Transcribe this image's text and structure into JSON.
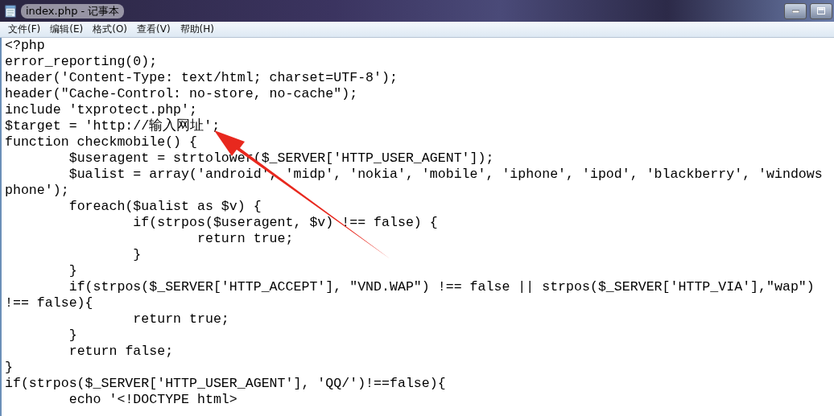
{
  "window": {
    "title": "index.php - 记事本"
  },
  "menu": [
    "文件(F)",
    "编辑(E)",
    "格式(O)",
    "查看(V)",
    "帮助(H)"
  ],
  "editor": {
    "lines": [
      "<?php",
      "error_reporting(0);",
      "header('Content-Type: text/html; charset=UTF-8');",
      "header(\"Cache-Control: no-store, no-cache\");",
      "include 'txprotect.php';",
      "$target = 'http://输入网址';",
      "function checkmobile() {",
      "\t$useragent = strtolower($_SERVER['HTTP_USER_AGENT']);",
      "\t$ualist = array('android', 'midp', 'nokia', 'mobile', 'iphone', 'ipod', 'blackberry', 'windows",
      "phone');",
      "\tforeach($ualist as $v) {",
      "\t\tif(strpos($useragent, $v) !== false) {",
      "\t\t\treturn true;",
      "\t\t}",
      "\t}",
      "\tif(strpos($_SERVER['HTTP_ACCEPT'], \"VND.WAP\") !== false || strpos($_SERVER['HTTP_VIA'],\"wap\")",
      "!== false){",
      "\t\treturn true;",
      "\t}",
      "\treturn false;",
      "}",
      "if(strpos($_SERVER['HTTP_USER_AGENT'], 'QQ/')!==false){",
      "\techo '<!DOCTYPE html>"
    ]
  }
}
